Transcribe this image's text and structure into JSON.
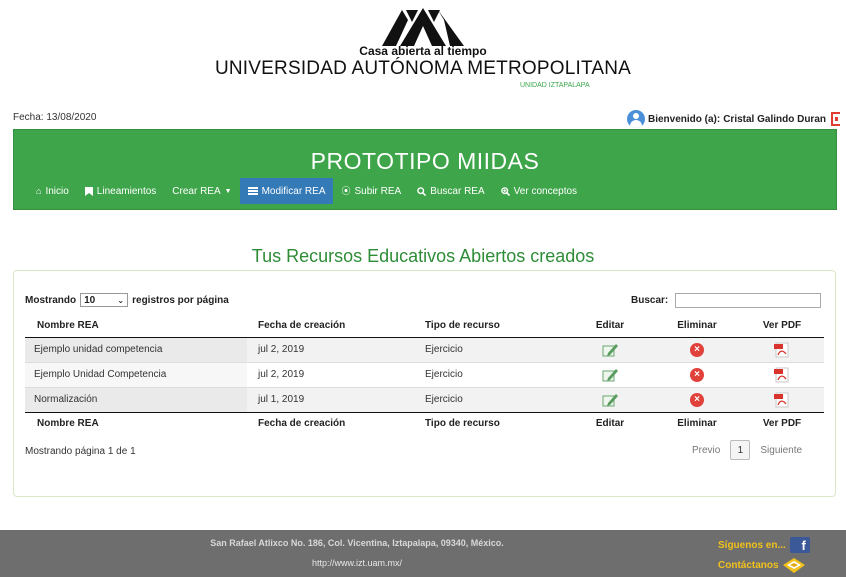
{
  "header": {
    "tagline": "Casa abierta al tiempo",
    "university": "UNIVERSIDAD AUTÓNOMA METROPOLITANA",
    "unit": "UNIDAD IZTAPALAPA"
  },
  "info_bar": {
    "date": "Fecha: 13/08/2020",
    "welcome": "Bienvenido (a):",
    "user_name": "Cristal Galindo Duran"
  },
  "navbar": {
    "title": "PROTOTIPO MIIDAS",
    "items": [
      {
        "label": "Inicio",
        "icon": "home-icon"
      },
      {
        "label": "Lineamientos",
        "icon": "bookmark-icon"
      },
      {
        "label": "Crear REA",
        "icon": "caret-down-icon"
      },
      {
        "label": "Modificar REA",
        "icon": "list-icon",
        "active": true
      },
      {
        "label": "Subir REA",
        "icon": "upload-circle-icon"
      },
      {
        "label": "Buscar REA",
        "icon": "search-icon"
      },
      {
        "label": "Ver conceptos",
        "icon": "zoom-icon"
      }
    ],
    "active_color": "#337ab7",
    "bar_color": "#3fa54a"
  },
  "main": {
    "heading": "Tus Recursos Educativos Abiertos creados",
    "length": {
      "prefix": "Mostrando",
      "value": "10",
      "suffix": "registros por página"
    },
    "search_label": "Buscar:",
    "search_value": "",
    "columns": [
      "Nombre REA",
      "Fecha de creación",
      "Tipo de recurso",
      "Editar",
      "Eliminar",
      "Ver PDF"
    ],
    "rows": [
      {
        "name": "Ejemplo unidad competencia",
        "date": "jul 2, 2019",
        "type": "Ejercicio"
      },
      {
        "name": "Ejemplo Unidad Competencia",
        "date": "jul 2, 2019",
        "type": "Ejercicio"
      },
      {
        "name": "Normalización",
        "date": "jul 1, 2019",
        "type": "Ejercicio"
      }
    ],
    "info": "Mostrando página 1 de 1",
    "pager": {
      "prev": "Previo",
      "current": "1",
      "next": "Siguiente"
    }
  },
  "footer": {
    "address": "San Rafael Atlixco No. 186, Col. Vicentina, Iztapalapa, 09340, México.",
    "url": "http://www.izt.uam.mx/",
    "follow": "Síguenos en...",
    "contact": "Contáctanos"
  }
}
